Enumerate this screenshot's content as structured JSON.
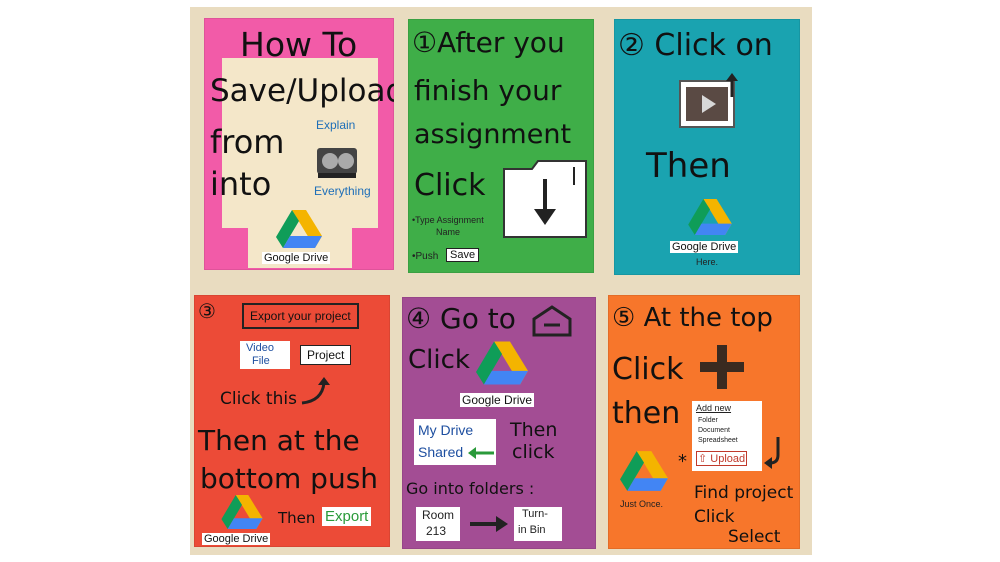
{
  "colors": {
    "board": "#e9dcc0",
    "pink": "#f25ba8",
    "green": "#3fae48",
    "teal": "#1aa3b0",
    "red": "#ec4b37",
    "purple": "#a34d94",
    "orange": "#f7762b"
  },
  "card1": {
    "title_line1": "How To",
    "title_line2": "Save/Upload",
    "title_line3": "from",
    "title_line4": "into",
    "app_line1": "Explain",
    "app_line2": "Everything",
    "drive_label": "Google Drive"
  },
  "card2": {
    "line1": "①After you",
    "line2": "finish your",
    "line3": "assignment",
    "line4": "Click",
    "note1a": "•Type Assignment",
    "note1b": "Name",
    "note2_prefix": "•Push",
    "note2_button": "Save"
  },
  "card3": {
    "line1": "② Click on",
    "line2": "Then",
    "drive_label": "Google Drive",
    "small": "Here."
  },
  "card4": {
    "step": "③",
    "export_box": "Export your project",
    "option1_a": "Video",
    "option1_b": "File",
    "option2": "Project",
    "click_this": "Click this",
    "line1": "Then at the",
    "line2": "bottom push",
    "drive_label": "Google Drive",
    "then": "Then",
    "export_button": "Export"
  },
  "card5": {
    "line1": "④ Go to",
    "line2": "Click",
    "drive_label": "Google Drive",
    "my_drive": "My Drive",
    "shared": "Shared",
    "then_click_a": "Then",
    "then_click_b": "click",
    "go_into": "Go into folders :",
    "room_a": "Room",
    "room_b": "213",
    "turn_a": "Turn-",
    "turn_b": "in Bin"
  },
  "card6": {
    "line1": "⑤ At the top",
    "line2": "Click",
    "line3": "then",
    "menu_title": "Add new",
    "menu_items": [
      "Folder",
      "Document",
      "Spreadsheet"
    ],
    "upload": "⇧ Upload",
    "star": "*",
    "just_once": "Just Once.",
    "find_a": "Find project",
    "find_b": "Click",
    "select": "Select"
  }
}
